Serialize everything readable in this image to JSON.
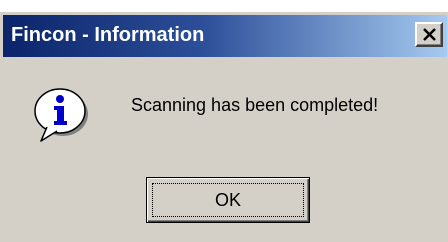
{
  "dialog": {
    "title": "Fincon - Information",
    "message": "Scanning has been completed!",
    "icon": "information-icon",
    "ok_label": "OK",
    "close_icon": "close-icon"
  },
  "colors": {
    "titlebar_start": "#0a246a",
    "titlebar_end": "#a6caf0",
    "window_face": "#d4d0c8",
    "title_text": "#ffffff"
  }
}
